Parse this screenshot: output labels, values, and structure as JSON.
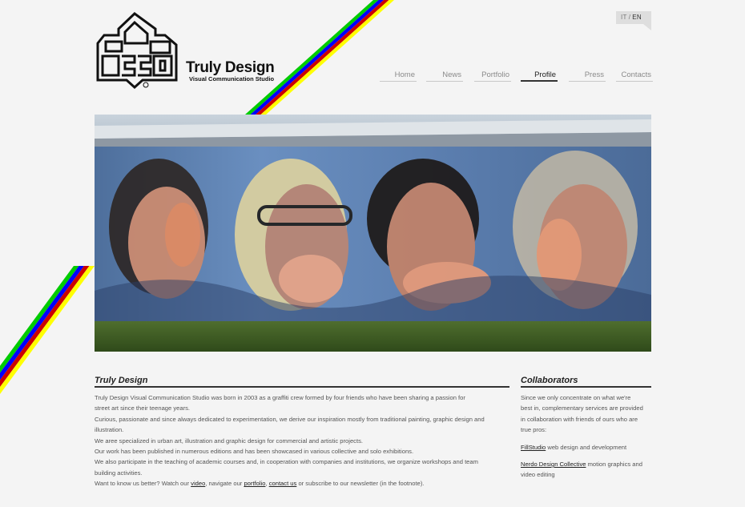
{
  "language": {
    "it": "IT",
    "separator": "/",
    "en": "EN"
  },
  "brand": {
    "name": "Truly Design",
    "subtitle": "Visual Communication Studio"
  },
  "nav": {
    "items": [
      {
        "label": "Home",
        "active": false
      },
      {
        "label": "News",
        "active": false
      },
      {
        "label": "Portfolio",
        "active": false
      },
      {
        "label": "Profile",
        "active": true
      },
      {
        "label": "Press",
        "active": false
      },
      {
        "label": "Contacts",
        "active": false
      }
    ]
  },
  "stripe_colors": [
    "#00cc00",
    "#0000ff",
    "#cc0000",
    "#ffff00"
  ],
  "about": {
    "title": "Truly Design",
    "lines": [
      "Truly Design Visual Communication Studio was born in 2003 as a graffiti crew formed by four friends who have been sharing a passion for",
      "street art since their teenage years.",
      "Curious, passionate and since always dedicated to experimentation, we derive our inspiration mostly from traditional painting, graphic design and",
      "illustration.",
      "We aree specialized in urban art, illustration and graphic design for commercial and artistic projects.",
      "Our work has been published in numerous editions and has been showcased in various collective and solo exhibitions.",
      "We also participate in the teaching of academic courses and, in cooperation with companies and institutions, we organize workshops and team",
      "building activities."
    ],
    "closing": {
      "prefix": "Want to know us better? Watch our ",
      "video_link": "video",
      "mid1": ", navigate our ",
      "portfolio_link": "portfolio",
      "mid2": ", ",
      "contact_link": "contact us",
      "suffix": " or subscribe to our newsletter (in the footnote)."
    }
  },
  "collaborators": {
    "title": "Collaborators",
    "intro": [
      "Since we only concentrate on what we're",
      "best in, complementary services are provided",
      "in collaboration with friends of ours who are",
      "true pros:"
    ],
    "items": [
      {
        "name": "FillStudio",
        "desc": " web design and development",
        "desc2": ""
      },
      {
        "name": "Nerdo Design Collective",
        "desc": " motion graphics and",
        "desc2": "video editing"
      }
    ]
  }
}
